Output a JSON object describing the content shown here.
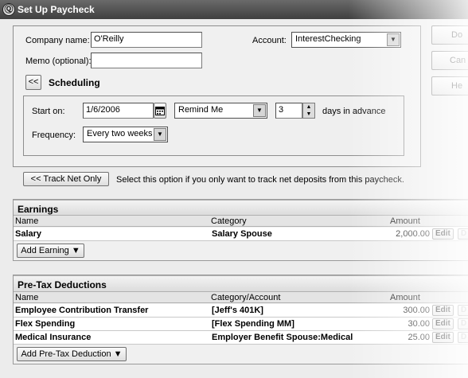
{
  "window": {
    "title": "Set Up Paycheck"
  },
  "form": {
    "company_label": "Company name:",
    "company_value": "O'Reilly",
    "memo_label": "Memo (optional):",
    "memo_value": "",
    "account_label": "Account:",
    "account_value": "InterestChecking",
    "scheduling_toggle": "<<",
    "scheduling_label": "Scheduling"
  },
  "scheduling": {
    "start_label": "Start on:",
    "start_value": "1/6/2006",
    "remind_value": "Remind Me",
    "days_value": "3",
    "days_suffix": "days in advance",
    "frequency_label": "Frequency:",
    "frequency_value": "Every two weeks"
  },
  "side_buttons": {
    "done": "Do",
    "cancel": "Can",
    "help": "He"
  },
  "track": {
    "button": "<< Track Net Only",
    "hint": "Select this option if you only want to track net deposits from this paycheck."
  },
  "earnings": {
    "title": "Earnings",
    "columns": {
      "name": "Name",
      "category": "Category",
      "amount": "Amount"
    },
    "rows": [
      {
        "name": "Salary",
        "category": "Salary Spouse",
        "amount": "2,000.00"
      }
    ],
    "add_button": "Add Earning ▼"
  },
  "pretax": {
    "title": "Pre-Tax Deductions",
    "columns": {
      "name": "Name",
      "category": "Category/Account",
      "amount": "Amount"
    },
    "rows": [
      {
        "name": "Employee Contribution Transfer",
        "category": "[Jeff's 401K]",
        "amount": "300.00"
      },
      {
        "name": "Flex Spending",
        "category": "[Flex Spending MM]",
        "amount": "30.00"
      },
      {
        "name": "Medical Insurance",
        "category": "Employer Benefit Spouse:Medical",
        "amount": "25.00"
      }
    ],
    "add_button": "Add Pre-Tax Deduction ▼"
  },
  "row_edit_label": "Edit",
  "row_delete_label": "D",
  "icons": {
    "app": "quicken-logo-icon",
    "calendar": "calendar-icon",
    "dropdown": "chevron-down-icon",
    "spinner": "spinner-arrows-icon"
  }
}
